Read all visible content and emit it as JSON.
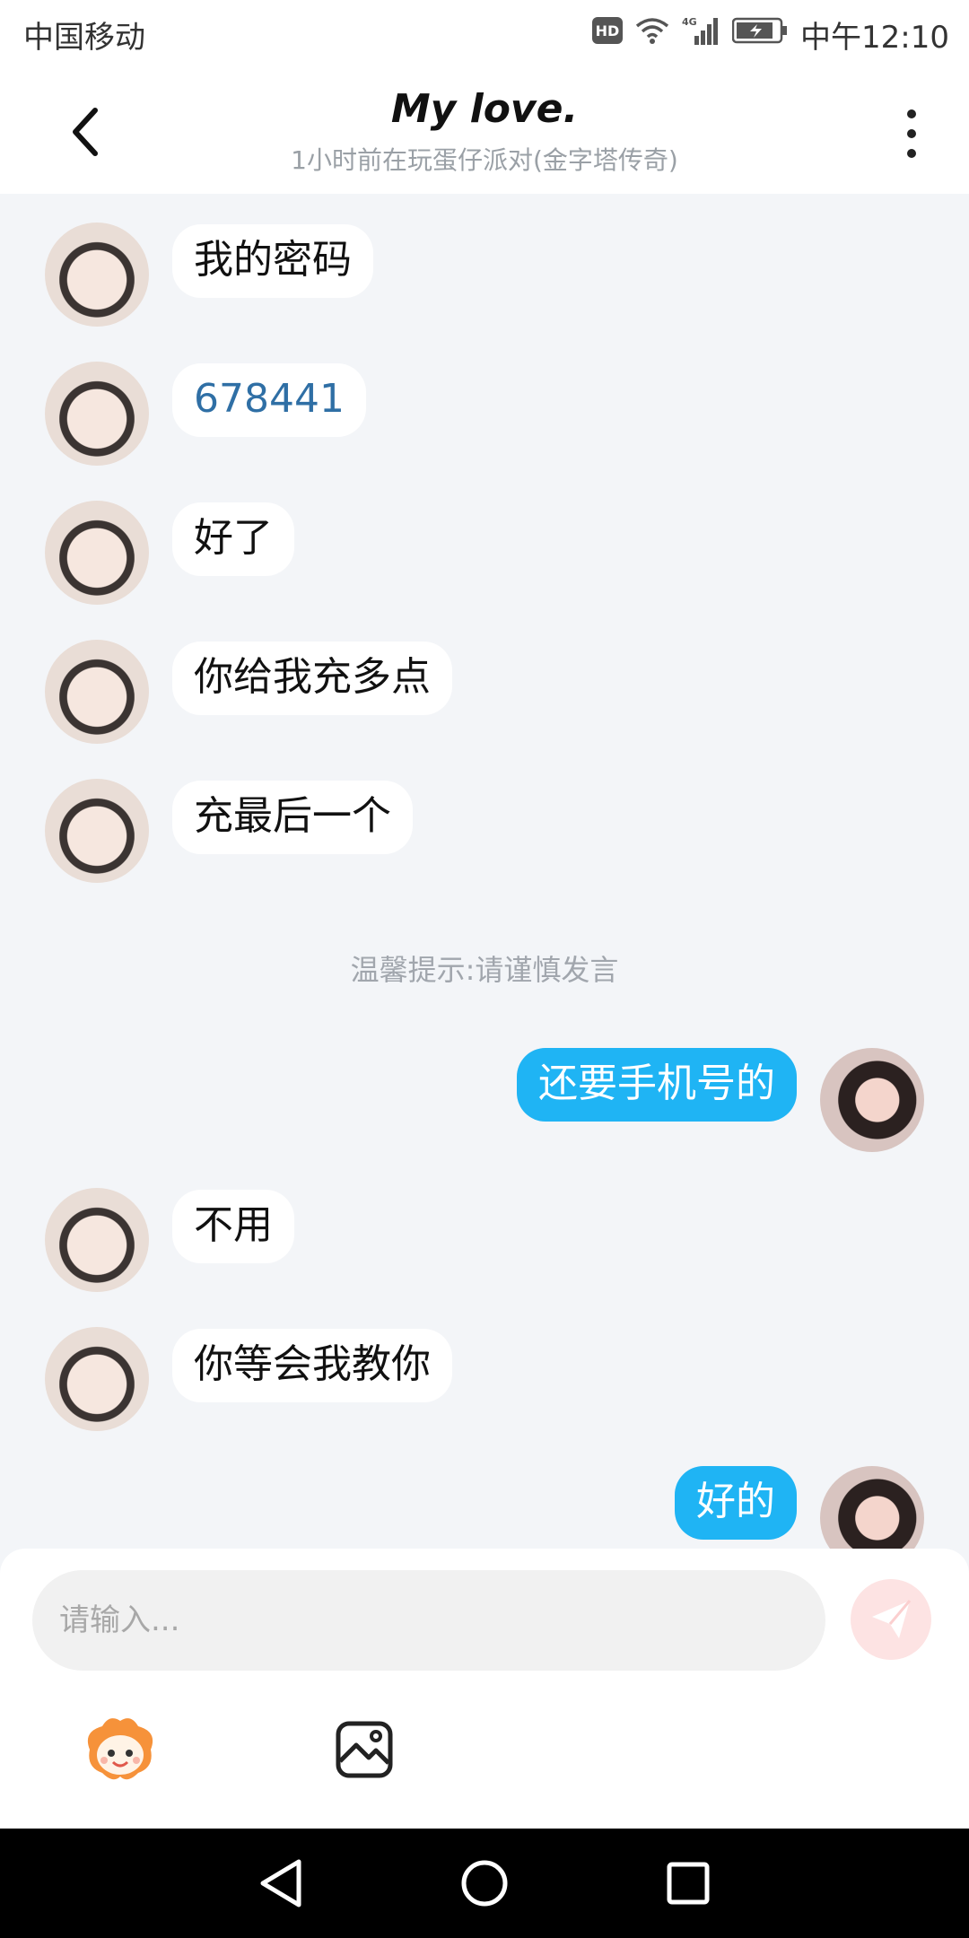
{
  "status_bar": {
    "carrier": "中国移动",
    "hd_label": "HD",
    "network": "4G",
    "time": "中午12:10"
  },
  "header": {
    "title": "My love.",
    "subtitle": "1小时前在玩蛋仔派对(金字塔传奇)"
  },
  "messages": [
    {
      "from": "other",
      "text": "我的密码"
    },
    {
      "from": "other",
      "text": "678441"
    },
    {
      "from": "other",
      "text": "好了"
    },
    {
      "from": "other",
      "text": "你给我充多点"
    },
    {
      "from": "other",
      "text": "充最后一个"
    },
    {
      "from": "me",
      "text": "还要手机号的"
    },
    {
      "from": "other",
      "text": "不用"
    },
    {
      "from": "other",
      "text": "你等会我教你"
    },
    {
      "from": "me",
      "text": "好的"
    }
  ],
  "notice": "温馨提示:请谨慎发言",
  "input": {
    "placeholder": "请输入...",
    "value": ""
  },
  "icons": {
    "back": "chevron-left-icon",
    "more": "more-vertical-icon",
    "send": "send-icon",
    "emoji": "mascot-emoji-icon",
    "image": "image-icon",
    "nav_back": "triangle-back-icon",
    "nav_home": "circle-home-icon",
    "nav_recent": "square-recent-icon"
  },
  "colors": {
    "my_bubble": "#1fb4f4",
    "other_bubble": "#ffffff",
    "number_text": "#2f6fa5",
    "send_button_bg": "#fde3e3",
    "chat_background": "#f3f5f8"
  }
}
